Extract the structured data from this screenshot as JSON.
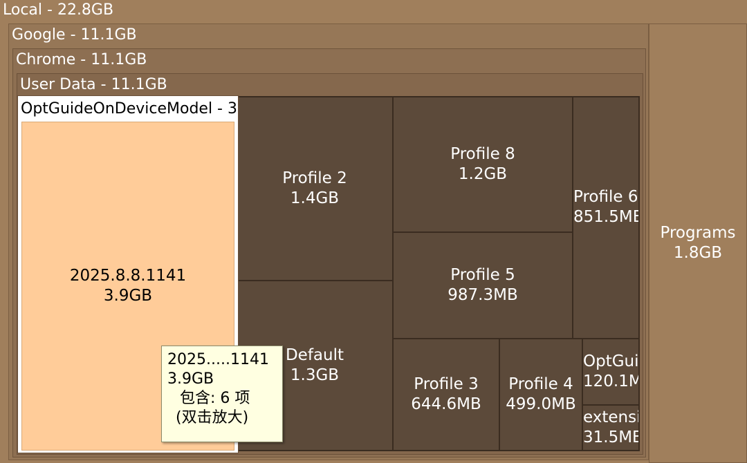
{
  "local": {
    "label": "Local - 22.8GB"
  },
  "google": {
    "label": "Google - 11.1GB"
  },
  "chrome": {
    "label": "Chrome - 11.1GB"
  },
  "user_data": {
    "label": "User Data - 11.1GB"
  },
  "opt_model": {
    "label": "OptGuideOnDeviceModel - 3"
  },
  "cells": {
    "version": {
      "name": "2025.8.8.1141",
      "size": "3.9GB"
    },
    "profile2": {
      "name": "Profile 2",
      "size": "1.4GB"
    },
    "default": {
      "name": "Default",
      "size": "1.3GB"
    },
    "profile8": {
      "name": "Profile 8",
      "size": "1.2GB"
    },
    "profile5": {
      "name": "Profile 5",
      "size": "987.3MB"
    },
    "profile6": {
      "name": "Profile 6",
      "size": "851.5MB"
    },
    "profile3": {
      "name": "Profile 3",
      "size": "644.6MB"
    },
    "profile4": {
      "name": "Profile 4",
      "size": "499.0MB"
    },
    "optgui": {
      "name": "OptGui",
      "size": "120.1M"
    },
    "extensi": {
      "name": "extensi",
      "size": "31.5MB"
    },
    "programs": {
      "name": "Programs",
      "size": "1.8GB"
    }
  },
  "tooltip": {
    "line1": "2025.....1141",
    "line2": "3.9GB",
    "line3": "包含: 6 项",
    "line4": "(双击放大)"
  },
  "colors": {
    "local_bg": "#a07f5c",
    "google_bg": "#967757",
    "chrome_bg": "#8d6f52",
    "user_data_bg": "#85684d",
    "cell_bg": "#5c4a3a",
    "selected_bg": "#ffcc99",
    "tooltip_bg": "#ffffe1"
  }
}
